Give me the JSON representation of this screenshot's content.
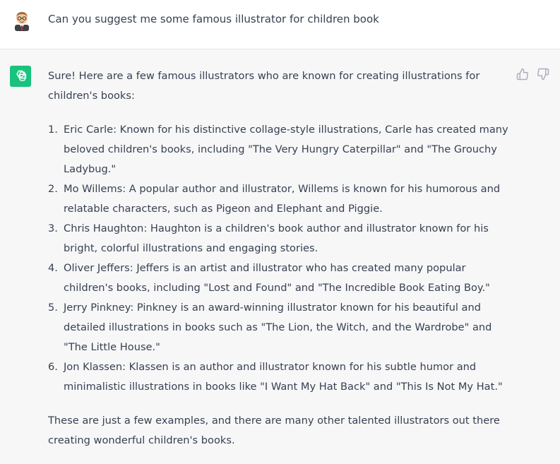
{
  "user_message": {
    "text": "Can you suggest me some famous illustrator for children book",
    "avatar_icon": "cartoon-person-avatar-icon"
  },
  "assistant_message": {
    "avatar_icon": "chatgpt-logo-icon",
    "brand_color": "#19c37d",
    "intro": "Sure! Here are a few famous illustrators who are known for creating illustrations for children's books:",
    "items": [
      {
        "num": "1.",
        "text": "Eric Carle: Known for his distinctive collage-style illustrations, Carle has created many beloved children's books, including \"The Very Hungry Caterpillar\" and \"The Grouchy Ladybug.\""
      },
      {
        "num": "2.",
        "text": "Mo Willems: A popular author and illustrator, Willems is known for his humorous and relatable characters, such as Pigeon and Elephant and Piggie."
      },
      {
        "num": "3.",
        "text": "Chris Haughton: Haughton is a children's book author and illustrator known for his bright, colorful illustrations and engaging stories."
      },
      {
        "num": "4.",
        "text": "Oliver Jeffers: Jeffers is an artist and illustrator who has created many popular children's books, including \"Lost and Found\" and \"The Incredible Book Eating Boy.\""
      },
      {
        "num": "5.",
        "text": "Jerry Pinkney: Pinkney is an award-winning illustrator known for his beautiful and detailed illustrations in books such as \"The Lion, the Witch, and the Wardrobe\" and \"The Little House.\""
      },
      {
        "num": "6.",
        "text": "Jon Klassen: Klassen is an author and illustrator known for his subtle humor and minimalistic illustrations in books like \"I Want My Hat Back\" and \"This Is Not My Hat.\""
      }
    ],
    "outro": "These are just a few examples, and there are many other talented illustrators out there creating wonderful children's books.",
    "feedback_icons": [
      "thumbs-up-icon",
      "thumbs-down-icon"
    ]
  }
}
